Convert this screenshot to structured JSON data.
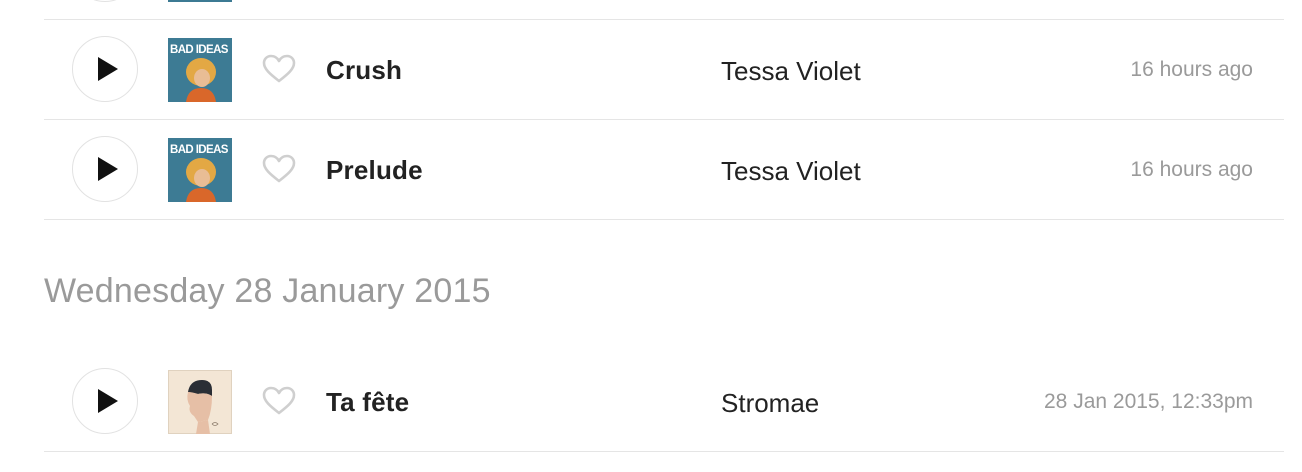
{
  "groups": {
    "today": {
      "tracks": [
        {
          "name": "",
          "artist": "",
          "time": ""
        },
        {
          "name": "Crush",
          "artist": "Tessa Violet",
          "time": "16 hours ago"
        },
        {
          "name": "Prelude",
          "artist": "Tessa Violet",
          "time": "16 hours ago"
        }
      ]
    },
    "wed_28_jan_2015": {
      "heading": "Wednesday 28 January 2015",
      "tracks": [
        {
          "name": "Ta fête",
          "artist": "Stromae",
          "time": "28 Jan 2015, 12:33pm"
        }
      ]
    }
  },
  "album_art": {
    "bad_ideas": {
      "text": "BAD IDEAS",
      "bg": "#3d7b94",
      "hair": "#e3a844",
      "shirt": "#d9672a"
    },
    "racine_carree": {
      "bg": "#f3e6d5"
    }
  },
  "icons": {
    "play": "play-icon",
    "heart": "heart-outline-icon"
  },
  "colors": {
    "text_primary": "#222222",
    "text_muted": "#9a9a9a",
    "divider": "#e5e5e5",
    "heart": "#cfcfcf"
  }
}
